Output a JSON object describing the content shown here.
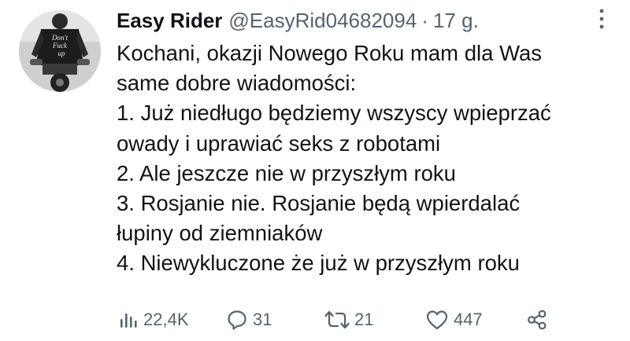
{
  "tweet": {
    "author": {
      "display_name": "Easy Rider",
      "handle": "@EasyRid04682094",
      "avatar_text": "Don't Fuck up"
    },
    "separator": "·",
    "time": "17 g.",
    "lines": [
      "Kochani, okazji Nowego Roku mam dla Was",
      "same dobre wiadomości:",
      "1. Już niedługo będziemy wszyscy wpieprzać",
      "owady i uprawiać seks z robotami",
      "2. Ale jeszcze nie w przyszłym roku",
      "3. Rosjanie nie. Rosjanie będą wpierdalać",
      "łupiny od ziemniaków",
      "4. Niewykluczone że już w przyszłym roku"
    ],
    "actions": {
      "views": {
        "icon": "analytics-icon",
        "count": "22,4K"
      },
      "reply": {
        "icon": "reply-icon",
        "count": "31"
      },
      "retweet": {
        "icon": "retweet-icon",
        "count": "21"
      },
      "like": {
        "icon": "heart-icon",
        "count": "447"
      },
      "share": {
        "icon": "share-icon"
      }
    },
    "colors": {
      "text": "#0f1419",
      "secondary": "#536471"
    }
  }
}
